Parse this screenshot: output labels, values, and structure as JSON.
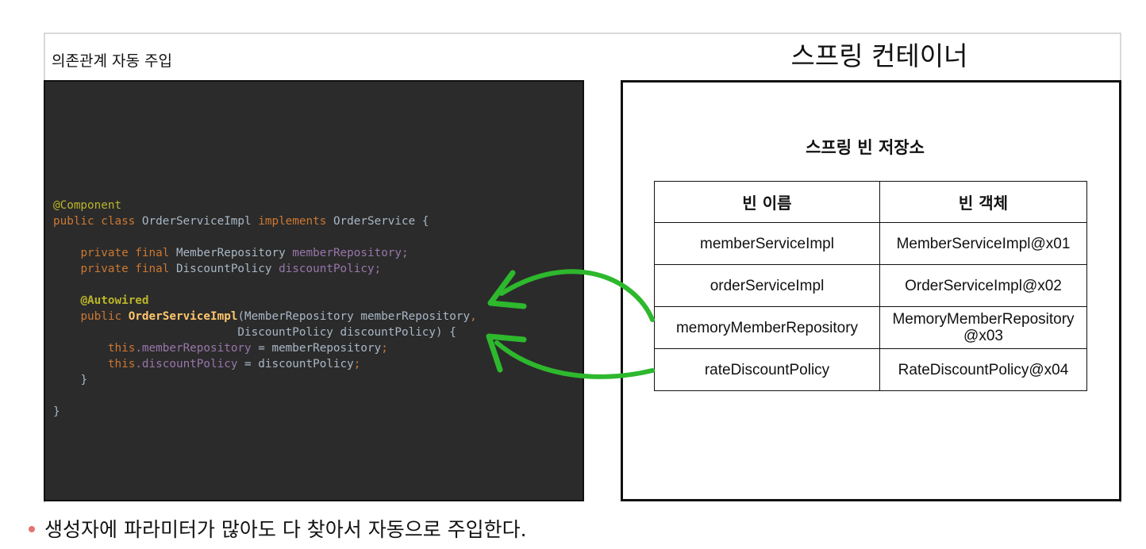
{
  "left_title": "의존관계 자동 주입",
  "container_title": "스프링 컨테이너",
  "code": {
    "annotation_component": "@Component",
    "kw_public_class": "public class",
    "class_name": "OrderServiceImpl",
    "kw_implements": "implements",
    "interface_name": "OrderService {",
    "kw_private_final": "private final",
    "member_repo_type": "MemberRepository",
    "member_repo_field": "memberRepository;",
    "discount_policy_type": "DiscountPolicy",
    "discount_policy_field": "discountPolicy;",
    "annotation_autowired": "@Autowired",
    "kw_public": "public",
    "constructor_name": "OrderServiceImpl",
    "ctor_param1": "(MemberRepository memberRepository",
    "comma": ",",
    "ctor_param2": "DiscountPolicy discountPolicy) {",
    "kw_this": "this",
    "this_member_field": ".memberRepository",
    "assign_member": " = memberRepository",
    "this_discount_field": ".discountPolicy",
    "assign_discount": " = discountPolicy",
    "semicolon": ";",
    "close_inner": "}",
    "close_outer": "}"
  },
  "bean_repository": {
    "title": "스프링 빈 저장소",
    "headers": [
      "빈 이름",
      "빈 객체"
    ],
    "rows": [
      [
        "memberServiceImpl",
        "MemberServiceImpl@x01"
      ],
      [
        "orderServiceImpl",
        "OrderServiceImpl@x02"
      ],
      [
        "memoryMemberRepository",
        "MemoryMemberRepository\n@x03"
      ],
      [
        "rateDiscountPolicy",
        "RateDiscountPolicy@x04"
      ]
    ]
  },
  "arrow_color": "#2db82d",
  "caption": "생성자에 파라미터가 많아도 다 찾아서 자동으로 주입한다.",
  "bullet_color": "#e57373"
}
